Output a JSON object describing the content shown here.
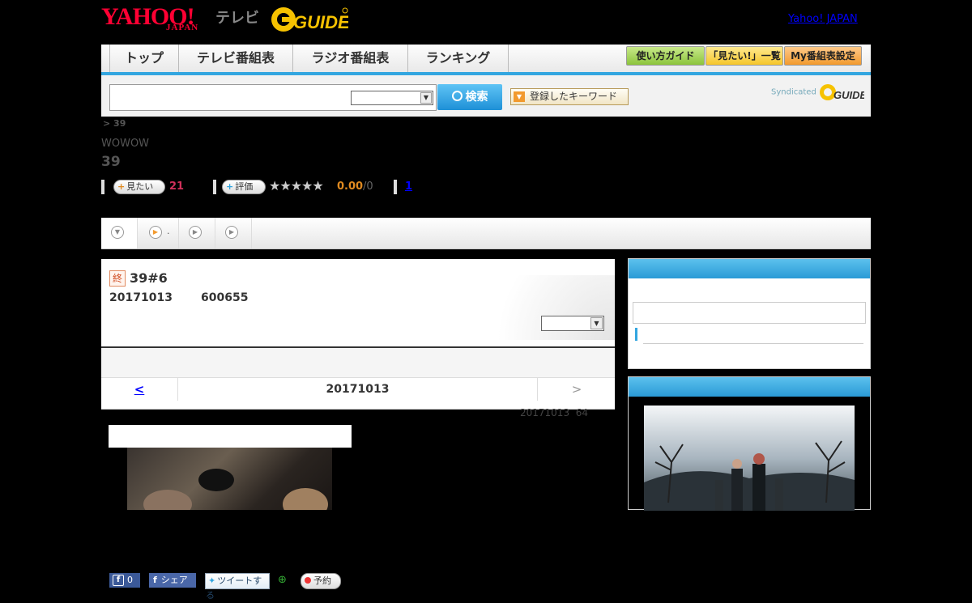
{
  "header": {
    "logo_yahoo": "YAHOO!",
    "logo_japan": "JAPAN",
    "logo_tv": "テレビ",
    "logo_gguide": "G GUIDE",
    "yahoo_japan_link": "Yahoo! JAPAN"
  },
  "nav": {
    "tabs": [
      {
        "label": "トップ"
      },
      {
        "label": "テレビ番組表"
      },
      {
        "label": "ラジオ番組表"
      },
      {
        "label": "ランキング"
      }
    ],
    "right_buttons": [
      {
        "label": "使い方ガイド"
      },
      {
        "label": "「見たい!」一覧"
      },
      {
        "label": "My番組表設定"
      }
    ]
  },
  "search": {
    "placeholder": "",
    "button_label": "検索",
    "keyword_button": "登録したキーワード",
    "syndicated": "Syndicated"
  },
  "program": {
    "breadcrumb": "> 39",
    "channel": "WOWOW",
    "title": "39",
    "want_label": "見たい",
    "want_count": "21",
    "rate_label": "評価",
    "rating_value": "0.00",
    "rating_count": "/0",
    "link_count": "1"
  },
  "tabs": {
    "tab2_suffix": "."
  },
  "episode": {
    "status_badge": "終",
    "title": "39#6",
    "date": "20171013",
    "id_number": "600655",
    "fb_like_count": "0",
    "fb_share": "シェア",
    "tweet": "ツイートする",
    "reserve": "予約"
  },
  "date_nav": {
    "prev": "<",
    "date": "20171013",
    "next": ">"
  },
  "meta_line": "20171013  64",
  "colors": {
    "accent_blue": "#33a6e0",
    "yahoo_red": "#ff0033",
    "want_count": "#d0305a",
    "rating": "#e08a20"
  }
}
